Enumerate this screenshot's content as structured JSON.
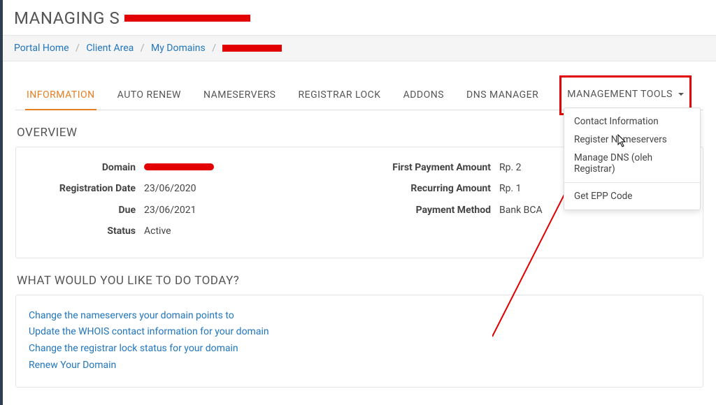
{
  "page_title_prefix": "MANAGING S",
  "breadcrumbs": {
    "items": [
      "Portal Home",
      "Client Area",
      "My Domains"
    ]
  },
  "tabs": {
    "items": [
      "INFORMATION",
      "AUTO RENEW",
      "NAMESERVERS",
      "REGISTRAR LOCK",
      "ADDONS",
      "DNS MANAGER",
      "MANAGEMENT TOOLS"
    ],
    "active_index": 0,
    "dropdown_index": 6
  },
  "overview": {
    "heading": "OVERVIEW",
    "left": {
      "domain_label": "Domain",
      "registration_date_label": "Registration Date",
      "registration_date_value": "23/06/2020",
      "due_label": "Due",
      "due_value": "23/06/2021",
      "status_label": "Status",
      "status_value": "Active"
    },
    "right": {
      "first_payment_label": "First Payment Amount",
      "first_payment_value": "Rp. 2",
      "recurring_label": "Recurring Amount",
      "recurring_value": "Rp. 1",
      "payment_method_label": "Payment Method",
      "payment_method_value": "Bank BCA"
    }
  },
  "actions": {
    "heading": "WHAT WOULD YOU LIKE TO DO TODAY?",
    "items": [
      "Change the nameservers your domain points to",
      "Update the WHOIS contact information for your domain",
      "Change the registrar lock status for your domain",
      "Renew Your Domain"
    ]
  },
  "management_tools_menu": {
    "items": [
      "Contact Information",
      "Register Nameservers",
      "Manage DNS (oleh Registrar)"
    ],
    "footer_item": "Get EPP Code"
  }
}
